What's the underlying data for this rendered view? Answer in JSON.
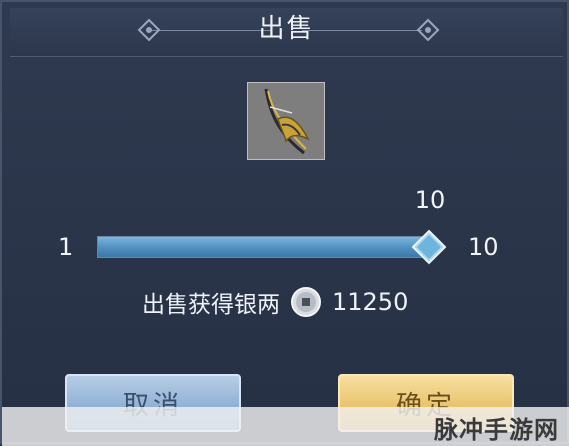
{
  "dialog": {
    "title": "出售"
  },
  "item": {
    "icon": "crossbow-weapon-icon"
  },
  "quantity": {
    "selected": "10",
    "min": "1",
    "max": "10",
    "fill_fraction": 1.0
  },
  "earnings": {
    "label": "出售获得银两",
    "currency_icon": "silver-coin-icon",
    "amount": "11250"
  },
  "buttons": {
    "cancel_label": "取消",
    "confirm_label": "确定"
  },
  "watermark": {
    "text": "脉冲手游网"
  },
  "colors": {
    "panel_bg": "#2a3448",
    "slider_fill": "#4f8fbf",
    "cancel_button": "#8fb0d4",
    "confirm_button": "#e8c26a"
  }
}
